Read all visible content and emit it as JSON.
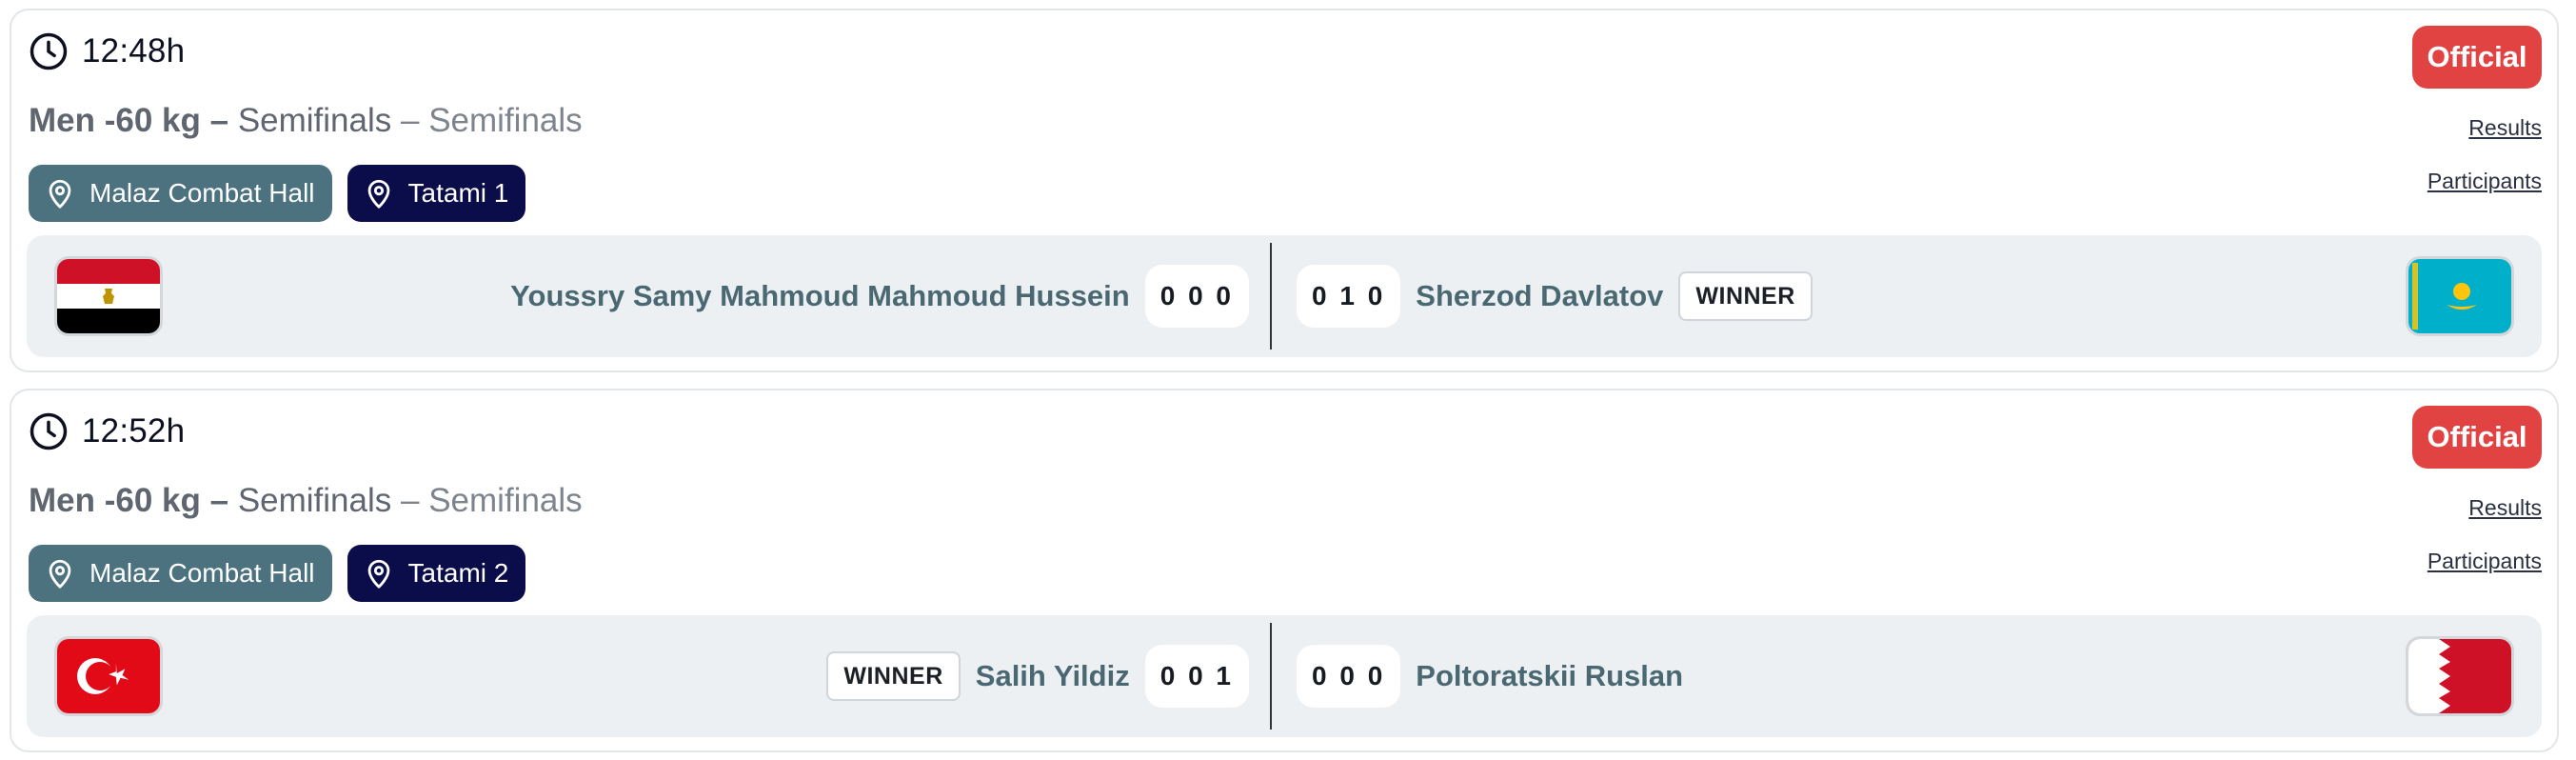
{
  "matches": [
    {
      "time": "12:48h",
      "category": "Men -60 kg –",
      "round": "Semifinals",
      "separator": "–",
      "phase": "Semifinals",
      "status": "Official",
      "links": {
        "results": "Results",
        "participants": "Participants"
      },
      "venue": "Malaz Combat Hall",
      "tatami": "Tatami 1",
      "left": {
        "name": "Youssry Samy Mahmoud Mahmoud Hussein",
        "score": "0 0 0",
        "flag_icon": "egypt-flag-icon",
        "winner": ""
      },
      "right": {
        "name": "Sherzod Davlatov",
        "score": "0 1 0",
        "flag_icon": "kazakhstan-flag-icon",
        "winner": "WINNER"
      }
    },
    {
      "time": "12:52h",
      "category": "Men -60 kg –",
      "round": "Semifinals",
      "separator": "–",
      "phase": "Semifinals",
      "status": "Official",
      "links": {
        "results": "Results",
        "participants": "Participants"
      },
      "venue": "Malaz Combat Hall",
      "tatami": "Tatami 2",
      "left": {
        "name": "Salih Yildiz",
        "score": "0 0 1",
        "flag_icon": "turkey-flag-icon",
        "winner": "WINNER"
      },
      "right": {
        "name": "Poltoratskii Ruslan",
        "score": "0 0 0",
        "flag_icon": "bahrain-flag-icon",
        "winner": ""
      }
    }
  ],
  "colors": {
    "official_badge": "#e14343",
    "venue_tag": "#4c7280",
    "tatami_tag": "#0b0c4a",
    "match_bar": "#edf0f2",
    "fighter_name": "#4a6872"
  }
}
